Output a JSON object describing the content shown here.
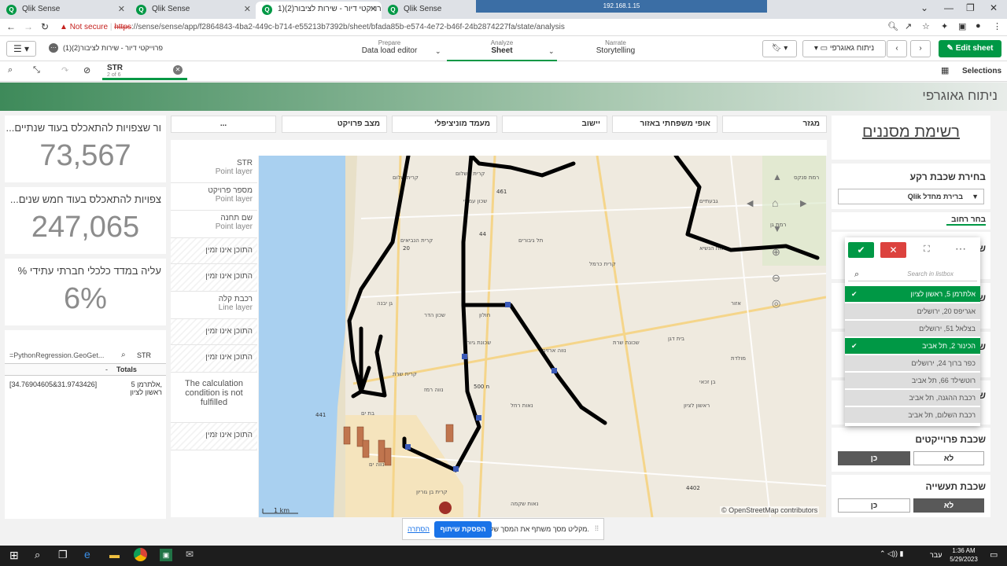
{
  "browser": {
    "tabs": [
      {
        "title": "Qlik Sense",
        "active": false
      },
      {
        "title": "Qlik Sense",
        "active": false
      },
      {
        "title": "פרוייקטי דיור - שירות לציבור(2)(1",
        "active": true
      },
      {
        "title": "Qlik Sense",
        "active": false
      }
    ],
    "remote_ip": "192.168.1.15",
    "not_secure": "Not secure",
    "url_prefix": "https",
    "url_rest": "://sense/sense/app/f2864843-4ba2-449c-b714-e55213b7392b/sheet/bfada85b-e574-4e72-b46f-24b2874227fa/state/analysis"
  },
  "qlik_nav": {
    "app_name": "פרוייקטי דיור - שירות לציבור(2)(1)",
    "prepare_small": "Prepare",
    "prepare_big": "Data load editor",
    "analyze_small": "Analyze",
    "analyze_big": "Sheet",
    "narrate_small": "Narrate",
    "narrate_big": "Storytelling",
    "sheet_dropdown": "ניתוח גאוגרפי",
    "edit_sheet": "Edit sheet",
    "selections": "Selections"
  },
  "selection_chip": {
    "field": "STR",
    "count": "2 of 6"
  },
  "sheet_title": "ניתוח גאוגרפי",
  "kpis": [
    {
      "title": "...ור שצפויות להתאכלס בעוד שנתיים",
      "value": "73,567"
    },
    {
      "title": "...צפויות להתאכלס בעוד חמש שנים",
      "value": "247,065"
    },
    {
      "title": "% עליה במדד כלכלי חברתי עתידי",
      "value": "6%"
    }
  ],
  "mini_table": {
    "formula": "=PythonRegression.GeoGet...",
    "search_label": "STR",
    "totals_label": "Totals",
    "dash": "-",
    "row_coord": "[34.76904605&31.9743426]",
    "row_addr1": "אלתרמן 5,",
    "row_addr2": "ראשון לציון"
  },
  "filters": [
    "מגזר",
    "אופי משפחתי באזור",
    "יישוב",
    "מעמד מוניציפלי",
    "מצב פרויקט",
    "..."
  ],
  "layers": [
    {
      "name": "STR",
      "sub": "Point layer",
      "hatch": false
    },
    {
      "name": "מספר פרויקט",
      "sub": "Point layer",
      "hatch": false
    },
    {
      "name": "שם תחנה",
      "sub": "Point layer",
      "hatch": false
    },
    {
      "name": "התוכן אינו זמין",
      "sub": "",
      "hatch": true
    },
    {
      "name": "התוכן אינו זמין",
      "sub": "",
      "hatch": true
    },
    {
      "name": "רכבת קלה",
      "sub": "Line layer",
      "hatch": false
    },
    {
      "name": "התוכן אינו זמין",
      "sub": "",
      "hatch": true
    },
    {
      "name": "התוכן אינו זמין",
      "sub": "",
      "hatch": true
    },
    {
      "name": "The calculation condition is not fulfilled",
      "sub": "",
      "hatch": false
    },
    {
      "name": "התוכן אינו זמין",
      "sub": "",
      "hatch": true
    }
  ],
  "map": {
    "scale": "1 km",
    "attribution": "© OpenStreetMap contributors",
    "places": [
      "קרית שלום",
      "שכון עממי",
      "קרית השלום",
      "קרית הנביאים",
      "חולון",
      "שכונת גיורא",
      "קרית שרת",
      "נווה רמז",
      "נאות רחל",
      "בת ים",
      "רמת הנשיא",
      "קרית כרמל",
      "אזור",
      "רמת פנקס",
      "גבעתיים",
      "רמת גן",
      "שכונת שרת",
      "קרית בן גוריון",
      "נאות שקמה",
      "ראשון לציון",
      "נווה ארזים",
      "בית דגן",
      "מולדת",
      "גן יבנה",
      "שכון הדר",
      "בן זכאי",
      "נווה ים",
      "תל גיבורים"
    ],
    "road_labels": [
      "461",
      "44",
      "20",
      "4402",
      "441",
      "500 n"
    ]
  },
  "right_panel": {
    "title": "רשימת מסננים",
    "basemap_label": "בחירת שכבת רקע",
    "basemap_value": "Qlik ברירת מחדל",
    "street_label": "בחר רחוב",
    "projects_label": "שכבת פרוייקטים",
    "projects_no": "לא",
    "projects_yes": "כן",
    "industry_label": "שכבת תעשייה",
    "industry_no": "לא",
    "industry_yes": "כן"
  },
  "listbox": {
    "search_placeholder": "Search in listbox",
    "items": [
      {
        "label": "אלתרמן 5, ראשון לציון",
        "selected": true
      },
      {
        "label": "אגריפס 20, ירושלים",
        "selected": false
      },
      {
        "label": "בצלאל 51, ירושלים",
        "selected": false
      },
      {
        "label": "הכינור 2, תל אביב",
        "selected": true
      },
      {
        "label": "כפר ברוך 24, ירושלים",
        "selected": false
      },
      {
        "label": "רוטשילד 66, תל אביב",
        "selected": false
      },
      {
        "label": "רכבת ההגנה, תל אביב",
        "selected": false
      },
      {
        "label": "רכבת השלום, תל אביב",
        "selected": false
      }
    ]
  },
  "share_bar": {
    "text": "מקליט מסך משתף את המסך שלך.",
    "stop": "הפסקת שיתוף",
    "hide": "הסתרה"
  },
  "taskbar": {
    "time": "1:36 AM",
    "date": "5/29/2023",
    "lang": "עבר"
  }
}
